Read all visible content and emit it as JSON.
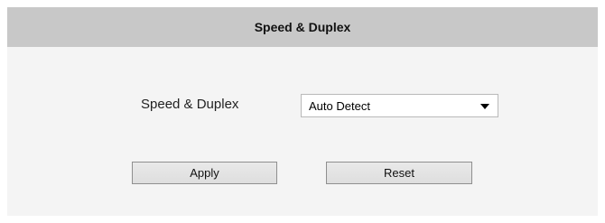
{
  "header": {
    "title": "Speed & Duplex"
  },
  "form": {
    "speed_duplex_label": "Speed & Duplex",
    "speed_duplex_value": "Auto Detect"
  },
  "actions": {
    "apply_label": "Apply",
    "reset_label": "Reset"
  }
}
